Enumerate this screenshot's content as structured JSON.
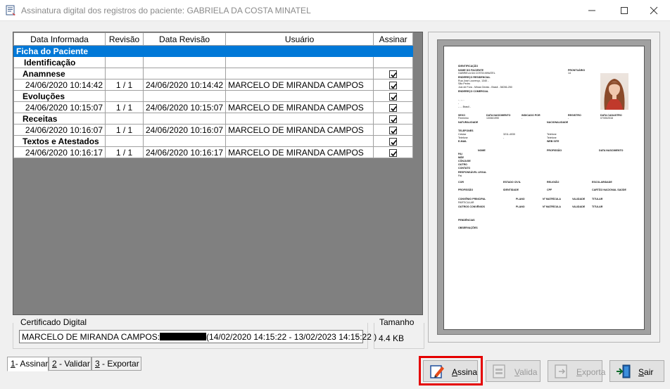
{
  "window": {
    "title": "Assinatura digital dos registros do paciente: GABRIELA DA COSTA MINATEL"
  },
  "grid": {
    "columns": [
      "Data Informada",
      "Revisão",
      "Data Revisão",
      "Usuário",
      "Assinar"
    ],
    "section": "Ficha do Paciente",
    "groups": [
      {
        "label": "Identificação",
        "rows": []
      },
      {
        "label": "Anamnese",
        "rows": [
          {
            "data": "24/06/2020 10:14:42",
            "revisao": "1 / 1",
            "data_revisao": "24/06/2020 10:14:42",
            "usuario": "MARCELO DE MIRANDA CAMPOS"
          }
        ]
      },
      {
        "label": "Evoluções",
        "rows": [
          {
            "data": "24/06/2020 10:15:07",
            "revisao": "1 / 1",
            "data_revisao": "24/06/2020 10:15:07",
            "usuario": "MARCELO DE MIRANDA CAMPOS"
          }
        ]
      },
      {
        "label": "Receitas",
        "rows": [
          {
            "data": "24/06/2020 10:16:07",
            "revisao": "1 / 1",
            "data_revisao": "24/06/2020 10:16:07",
            "usuario": "MARCELO DE MIRANDA CAMPOS"
          }
        ]
      },
      {
        "label": "Textos e Atestados",
        "rows": [
          {
            "data": "24/06/2020 10:16:17",
            "revisao": "1 / 1",
            "data_revisao": "24/06/2020 10:16:17",
            "usuario": "MARCELO DE MIRANDA CAMPOS"
          }
        ]
      }
    ]
  },
  "certificate": {
    "legend": "Certificado Digital",
    "value_prefix": "MARCELO DE MIRANDA CAMPOS:",
    "value_suffix": "(14/02/2020 14:15:22 - 13/02/2023 14:15:22 )"
  },
  "size": {
    "legend": "Tamanho",
    "value": "4.4 KB"
  },
  "tabs": [
    {
      "key": "1",
      "rest": "- Assinar"
    },
    {
      "key": "2",
      "rest": " - Validar"
    },
    {
      "key": "3",
      "rest": " - Exportar"
    }
  ],
  "buttons": {
    "assina": {
      "key": "A",
      "rest": "ssina"
    },
    "valida": {
      "key": "V",
      "rest": "alida"
    },
    "exporta": {
      "key": "E",
      "rest": "xporta"
    },
    "sair": {
      "key": "S",
      "rest": "air"
    }
  },
  "preview": {
    "identificacao": "IDENTIFICAÇÃO",
    "nome_label": "NOME DO PACIENTE",
    "nome_value": "GABRIELA DA COSTA MINATEL",
    "prontuario_label": "PRONTUÁRIO",
    "prontuario_value": "14",
    "endereco_label": "ENDEREÇO RESIDENCIAL",
    "endereco_l1": "Rua José Lourenço, 1340 -",
    "endereco_l2": "São Pedro",
    "endereco_l3": "Juiz de Fora - Minas Gerais - Brasil - 36036-250",
    "comercial_label": "ENDEREÇO COMERCIAL",
    "comercial_l1": "- , -, -",
    "comercial_l2": "-",
    "comercial_l3": "- - - Brasil -",
    "row1": [
      "SEXO",
      "DATA NASCIMENTO",
      "INDICADO POR",
      "REGISTRO",
      "DATA CADASTRO"
    ],
    "row1_vals": [
      "Feminino",
      "13/06/1990",
      "-",
      "-",
      "07/05/2016"
    ],
    "naturalidade": "NATURALIDADE",
    "nacionalidade": "NACIONALIDADE",
    "telefones": "TELEFONES",
    "tel_lines": [
      "Celular",
      "Telefone"
    ],
    "tel_vals": [
      "3211-4030",
      "-"
    ],
    "tel_right": [
      "Telefone",
      "Telefone"
    ],
    "email": "E-MAIL",
    "website": "WEB SITE",
    "parentes_head": [
      "NOME",
      "PROFISSÃO",
      "DATA NASCIMENTO"
    ],
    "parentes": [
      "PAI",
      "MÃE",
      "CÔNJUGE",
      "OUTRO",
      "CONTATO"
    ],
    "responsavel": "RESPONSÁVEL LEGAL",
    "responsavel_val": "Pai",
    "row_cor": [
      "COR",
      "ESTADO CIVIL",
      "RELIGIÃO",
      "ESCOLARIDADE"
    ],
    "row_prof": [
      "PROFISSÃO",
      "IDENTIDADE",
      "CPF",
      "CARTÃO NACIONAL SAÚDE"
    ],
    "convenio": [
      "CONVÊNIO PRINCIPAL",
      "PLANO",
      "Nº MATRÍCULA",
      "VALIDADE",
      "TITULAR"
    ],
    "convenio_val": "PARTICULAR",
    "outros": [
      "OUTROS CONVÊNIOS",
      "PLANO",
      "Nº MATRÍCULA",
      "VALIDADE",
      "TITULAR"
    ],
    "pendencias": "PENDÊNCIAS",
    "observacoes": "OBSERVAÇÕES"
  }
}
